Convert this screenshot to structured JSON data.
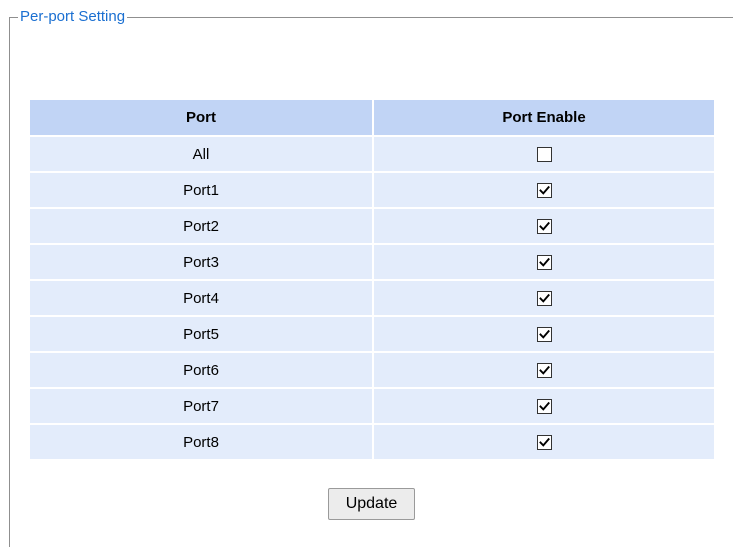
{
  "fieldset": {
    "legend": "Per-port Setting"
  },
  "table": {
    "headers": {
      "port": "Port",
      "enable": "Port Enable"
    },
    "rows": [
      {
        "port": "All",
        "enabled": false
      },
      {
        "port": "Port1",
        "enabled": true
      },
      {
        "port": "Port2",
        "enabled": true
      },
      {
        "port": "Port3",
        "enabled": true
      },
      {
        "port": "Port4",
        "enabled": true
      },
      {
        "port": "Port5",
        "enabled": true
      },
      {
        "port": "Port6",
        "enabled": true
      },
      {
        "port": "Port7",
        "enabled": true
      },
      {
        "port": "Port8",
        "enabled": true
      }
    ]
  },
  "actions": {
    "update_label": "Update"
  },
  "colors": {
    "legend_text": "#1a6fd1",
    "header_bg": "#c1d4f5",
    "row_bg": "#e3ecfb"
  }
}
